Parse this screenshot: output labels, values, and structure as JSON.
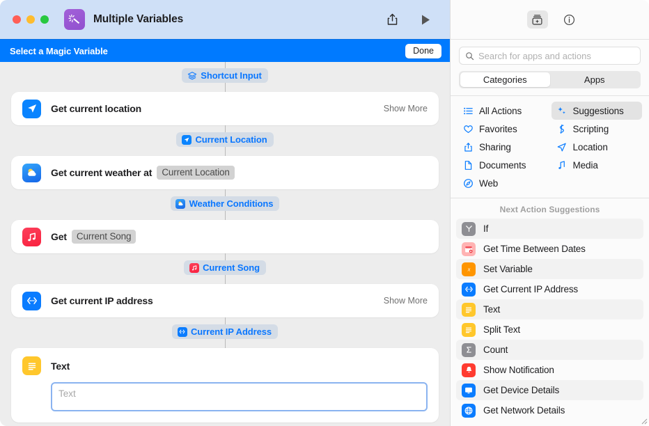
{
  "window": {
    "title": "Multiple Variables",
    "app_icon": "magic-wand-icon",
    "traffic_lights": [
      "close",
      "minimize",
      "zoom"
    ],
    "share_icon": "share-icon",
    "run_icon": "play-icon"
  },
  "magic_bar": {
    "title": "Select a Magic Variable",
    "done_label": "Done",
    "background": "#007AFF"
  },
  "workflow": {
    "input_pill": {
      "label": "Shortcut Input",
      "icon": "layers-icon",
      "color": "#0A77FF"
    },
    "steps": [
      {
        "title": "Get current location",
        "icon": "location-arrow-icon",
        "icon_color": "#0A84FF",
        "token": null,
        "show_more": "Show More",
        "output_pill": {
          "label": "Current Location",
          "icon": "location-arrow-icon"
        }
      },
      {
        "title": "Get current weather at",
        "icon": "weather-icon",
        "icon_color": "#1D7BF5",
        "token": "Current Location",
        "show_more": null,
        "output_pill": {
          "label": "Weather Conditions",
          "icon": "weather-icon"
        }
      },
      {
        "title": "Get",
        "icon": "music-note-icon",
        "icon_color": "#FB2D4C",
        "token": "Current Song",
        "show_more": null,
        "output_pill": {
          "label": "Current Song",
          "icon": "music-note-icon"
        }
      },
      {
        "title": "Get current IP address",
        "icon": "ip-address-icon",
        "icon_color": "#0A7CFF",
        "token": null,
        "show_more": "Show More",
        "output_pill": {
          "label": "Current IP Address",
          "icon": "ip-address-icon"
        }
      }
    ],
    "text_action": {
      "title": "Text",
      "icon": "text-lines-icon",
      "icon_color": "#FFC72C",
      "field_placeholder": "Text",
      "field_value": "",
      "field_focused": true
    }
  },
  "library": {
    "header_buttons": [
      {
        "name": "action-library-button",
        "icon": "library-add-icon",
        "active": true
      },
      {
        "name": "info-button",
        "icon": "info-circle-icon",
        "active": false
      }
    ],
    "search": {
      "placeholder": "Search for apps and actions",
      "value": "",
      "icon": "search-icon"
    },
    "segmented": {
      "options": [
        "Categories",
        "Apps"
      ],
      "selected": "Categories"
    },
    "categories": [
      {
        "label": "All Actions",
        "icon": "list-bullet-icon",
        "active": false
      },
      {
        "label": "Suggestions",
        "icon": "sparkles-icon",
        "active": true
      },
      {
        "label": "Favorites",
        "icon": "heart-icon",
        "active": false
      },
      {
        "label": "Scripting",
        "icon": "scripting-icon",
        "active": false
      },
      {
        "label": "Sharing",
        "icon": "share-icon",
        "active": false
      },
      {
        "label": "Location",
        "icon": "location-arrow-icon",
        "active": false
      },
      {
        "label": "Documents",
        "icon": "document-icon",
        "active": false
      },
      {
        "label": "Media",
        "icon": "music-note-icon",
        "active": false
      },
      {
        "label": "Web",
        "icon": "compass-icon",
        "active": false
      }
    ],
    "suggestions_title": "Next Action Suggestions",
    "suggestions": [
      {
        "label": "If",
        "icon": "branch-icon",
        "color": "#8E8E93"
      },
      {
        "label": "Get Time Between Dates",
        "icon": "calendar-icon",
        "color": "#FF6B6B"
      },
      {
        "label": "Set Variable",
        "icon": "variable-icon",
        "color": "#FF9500"
      },
      {
        "label": "Get Current IP Address",
        "icon": "ip-address-icon",
        "color": "#0A7CFF"
      },
      {
        "label": "Text",
        "icon": "text-lines-icon",
        "color": "#FFC72C"
      },
      {
        "label": "Split Text",
        "icon": "text-lines-icon",
        "color": "#FFC72C"
      },
      {
        "label": "Count",
        "icon": "sigma-icon",
        "color": "#8E8E93"
      },
      {
        "label": "Show Notification",
        "icon": "bell-icon",
        "color": "#FF3B30"
      },
      {
        "label": "Get Device Details",
        "icon": "display-icon",
        "color": "#0A7CFF"
      },
      {
        "label": "Get Network Details",
        "icon": "globe-icon",
        "color": "#0A7CFF"
      }
    ]
  }
}
